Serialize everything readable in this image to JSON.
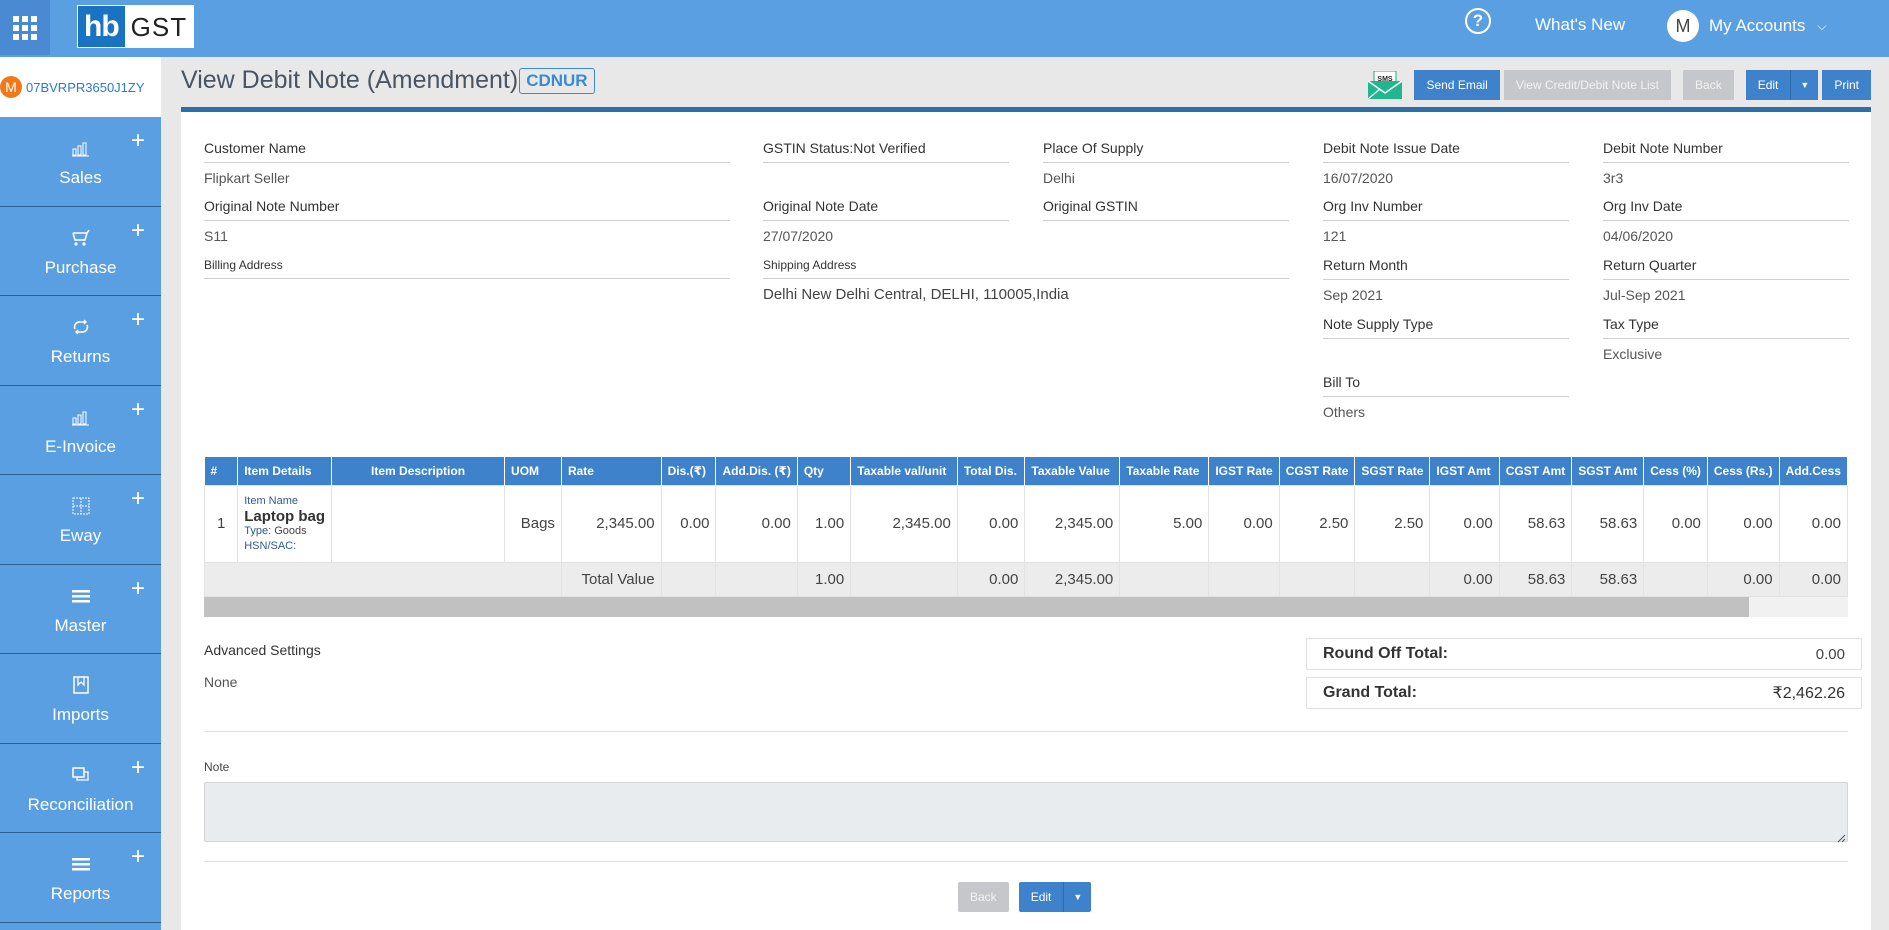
{
  "topbar": {
    "logo_hb": "hb",
    "logo_gst": "GST",
    "help_symbol": "?",
    "whats_new": "What's New",
    "account_initial": "M",
    "account_label": "My Accounts",
    "chevron": "⌄"
  },
  "sidebar": {
    "gstin_badge": "M",
    "gstin": "07BVRPR3650J1ZY",
    "items": [
      {
        "label": "Sales",
        "icon": "bar-chart-icon",
        "plus": true
      },
      {
        "label": "Purchase",
        "icon": "cart-icon",
        "plus": true
      },
      {
        "label": "Returns",
        "icon": "repeat-icon",
        "plus": true
      },
      {
        "label": "E-Invoice",
        "icon": "bar-chart-icon",
        "plus": true
      },
      {
        "label": "Eway",
        "icon": "grid-icon",
        "plus": true
      },
      {
        "label": "Master",
        "icon": "menu-icon",
        "plus": true
      },
      {
        "label": "Imports",
        "icon": "bookmark-icon",
        "plus": false
      },
      {
        "label": "Reconciliation",
        "icon": "copy-icon",
        "plus": true
      },
      {
        "label": "Reports",
        "icon": "menu-icon",
        "plus": true
      }
    ]
  },
  "header": {
    "title": "View Debit Note (Amendment)",
    "badge": "CDNUR",
    "sms_label": "SMS",
    "send_email": "Send Email",
    "view_list": "View Credit/Debit Note List",
    "back": "Back",
    "edit": "Edit",
    "print": "Print"
  },
  "fields": {
    "customer_name": {
      "label": "Customer Name",
      "value": "Flipkart Seller"
    },
    "gstin_status": {
      "label": "GSTIN Status:Not Verified",
      "value": ""
    },
    "place_of_supply": {
      "label": "Place Of Supply",
      "value": "Delhi"
    },
    "debit_note_issue_date": {
      "label": "Debit Note Issue Date",
      "value": "16/07/2020"
    },
    "debit_note_number": {
      "label": "Debit Note Number",
      "value": "3r3"
    },
    "original_note_number": {
      "label": "Original Note Number",
      "value": "S11"
    },
    "original_note_date": {
      "label": "Original Note Date",
      "value": "27/07/2020"
    },
    "original_gstin": {
      "label": "Original GSTIN",
      "value": ""
    },
    "org_inv_number": {
      "label": "Org Inv Number",
      "value": "121"
    },
    "org_inv_date": {
      "label": "Org Inv Date",
      "value": "04/06/2020"
    },
    "billing_address": {
      "label": "Billing Address",
      "value": ""
    },
    "shipping_address": {
      "label": "Shipping Address",
      "value": "Delhi New Delhi Central, DELHI, 110005,India"
    },
    "return_month": {
      "label": "Return Month",
      "value": "Sep 2021"
    },
    "return_quarter": {
      "label": "Return Quarter",
      "value": "Jul-Sep 2021"
    },
    "note_supply_type": {
      "label": "Note Supply Type",
      "value": ""
    },
    "tax_type": {
      "label": "Tax Type",
      "value": "Exclusive"
    },
    "bill_to": {
      "label": "Bill To",
      "value": "Others"
    }
  },
  "table": {
    "headers": [
      "#",
      "Item Details",
      "Item Description",
      "UOM",
      "Rate",
      "Dis.(₹)",
      "Add.Dis. (₹)",
      "Qty",
      "Taxable val/unit",
      "Total Dis.",
      "Taxable Value",
      "Taxable Rate",
      "IGST Rate",
      "CGST Rate",
      "SGST Rate",
      "IGST Amt",
      "CGST Amt",
      "SGST Amt",
      "Cess (%)",
      "Cess (Rs.)",
      "Add.Cess"
    ],
    "row": {
      "index": "1",
      "item_name_label": "Item Name",
      "item_name": "Laptop bag",
      "type_label": "Type:",
      "type_value": "Goods",
      "hsn_label": "HSN/SAC:",
      "description": "",
      "uom": "Bags",
      "rate": "2,345.00",
      "dis": "0.00",
      "add_dis": "0.00",
      "qty": "1.00",
      "taxable_val_unit": "2,345.00",
      "total_dis": "0.00",
      "taxable_value": "2,345.00",
      "taxable_rate": "5.00",
      "igst_rate": "0.00",
      "cgst_rate": "2.50",
      "sgst_rate": "2.50",
      "igst_amt": "0.00",
      "cgst_amt": "58.63",
      "sgst_amt": "58.63",
      "cess_pct": "0.00",
      "cess_rs": "0.00",
      "add_cess": "0.00"
    },
    "total": {
      "label": "Total Value",
      "qty": "1.00",
      "total_dis": "0.00",
      "taxable_value": "2,345.00",
      "igst_amt": "0.00",
      "cgst_amt": "58.63",
      "sgst_amt": "58.63",
      "cess_rs": "0.00",
      "add_cess": "0.00"
    },
    "scroll_fraction": 0.94
  },
  "advanced": {
    "title": "Advanced Settings",
    "value": "None"
  },
  "totals": {
    "round_off_label": "Round Off Total:",
    "round_off_value": "0.00",
    "grand_total_label": "Grand Total:",
    "grand_total_value": "₹2,462.26"
  },
  "note": {
    "label": "Note",
    "value": ""
  },
  "footer": {
    "back": "Back",
    "edit": "Edit"
  }
}
